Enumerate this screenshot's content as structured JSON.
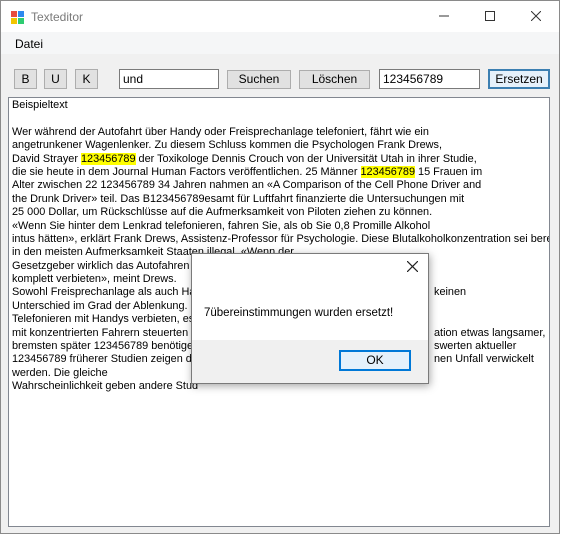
{
  "window": {
    "title": "Texteditor"
  },
  "menu": {
    "items": [
      {
        "label": "Datei"
      }
    ]
  },
  "toolbar": {
    "bold_label": "B",
    "underline_label": "U",
    "italic_label": "K",
    "search_value": "und",
    "search_label": "Suchen",
    "delete_label": "Löschen",
    "replace_value": "123456789",
    "replace_label": "Ersetzen"
  },
  "editor": {
    "lines": [
      [
        {
          "t": "Beispieltext"
        }
      ],
      [
        {
          "t": ""
        }
      ],
      [
        {
          "t": "Wer während der Autofahrt über Handy oder Freisprechanlage telefoniert, fährt wie ein"
        }
      ],
      [
        {
          "t": "angetrunkener Wagenlenker. Zu diesem Schluss kommen die Psychologen Frank Drews,"
        }
      ],
      [
        {
          "t": "David Strayer "
        },
        {
          "t": "123456789",
          "hl": true
        },
        {
          "t": " der Toxikologe Dennis Crouch von der Universität Utah in ihrer Studie,"
        }
      ],
      [
        {
          "t": "die sie heute in dem Journal Human Factors veröffentlichen. 25 Männer "
        },
        {
          "t": "123456789",
          "hl": true
        },
        {
          "t": " 15 Frauen im"
        }
      ],
      [
        {
          "t": "Alter zwischen 22 123456789 34 Jahren nahmen an «A Comparison of the Cell Phone Driver and"
        }
      ],
      [
        {
          "t": "the Drunk Driver» teil. Das B123456789esamt für Luftfahrt finanzierte die Untersuchungen mit"
        }
      ],
      [
        {
          "t": "25 000 Dollar, um Rückschlüsse auf die Aufmerksamkeit von Piloten ziehen zu können."
        }
      ],
      [
        {
          "t": "«Wenn Sie hinter dem Lenkrad telefonieren, fahren Sie, als ob Sie 0,8 Promille Alkohol"
        }
      ],
      [
        {
          "t": "intus hätten», erklärt Frank Drews, Assistenz-Professor für Psychologie. Diese Blutalkoholkonzentration sei bereits"
        }
      ],
      [
        {
          "t": "in den meisten Aufmerksamkeit Staaten illegal. «Wenn der"
        }
      ],
      [
        {
          "t": "Gesetzgeber wirklich das Autofahren s"
        }
      ],
      [
        {
          "t": "komplett verbieten», meint Drews."
        }
      ],
      [
        {
          "t": "Sowohl Freisprechanlage als auch Ha",
          "tail": "keinen"
        }
      ],
      [
        {
          "t": "Unterschied im Grad der Ablenkung. «"
        }
      ],
      [
        {
          "t": "Telefonieren mit Handys verbieten, es"
        }
      ],
      [
        {
          "t": "mit konzentrierten Fahrern steuerten di",
          "tail": "ation etwas langsamer,"
        }
      ],
      [
        {
          "t": "bremsten später 123456789 benötiger",
          "tail": "swerten aktueller"
        }
      ],
      [
        {
          "t": "123456789 früherer Studien zeigen die",
          "tail": "nen Unfall verwickelt"
        }
      ],
      [
        {
          "t": "werden. Die gleiche"
        }
      ],
      [
        {
          "t": "Wahrscheinlichkeit geben andere Stud"
        }
      ]
    ]
  },
  "dialog": {
    "close_label": "✕",
    "message": "7übereinstimmungen wurden ersetzt!",
    "ok_label": "OK"
  }
}
